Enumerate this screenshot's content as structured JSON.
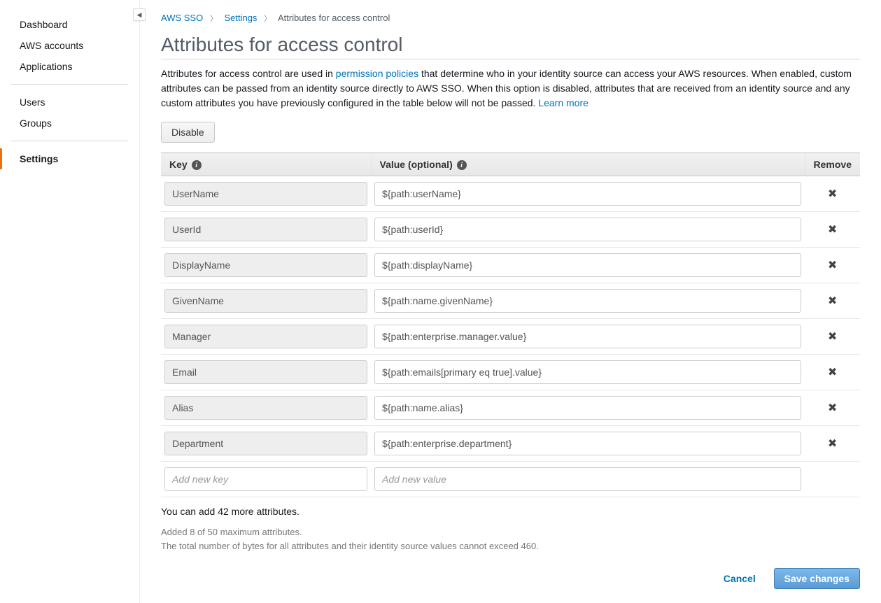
{
  "sidebar": {
    "group1": [
      {
        "label": "Dashboard"
      },
      {
        "label": "AWS accounts"
      },
      {
        "label": "Applications"
      }
    ],
    "group2": [
      {
        "label": "Users"
      },
      {
        "label": "Groups"
      }
    ],
    "group3": [
      {
        "label": "Settings",
        "active": true
      }
    ]
  },
  "breadcrumb": {
    "root": "AWS SSO",
    "mid": "Settings",
    "current": "Attributes for access control"
  },
  "title": "Attributes for access control",
  "description": {
    "part1": "Attributes for access control are used in ",
    "link1": "permission policies",
    "part2": " that determine who in your identity source can access your AWS resources. When enabled, custom attributes can be passed from an identity source directly to AWS SSO. When this option is disabled, attributes that are received from an identity source and any custom attributes you have previously configured in the table below will not be passed. ",
    "link2": "Learn more"
  },
  "buttons": {
    "disable": "Disable",
    "cancel": "Cancel",
    "save": "Save changes"
  },
  "table": {
    "headers": {
      "key": "Key",
      "value": "Value (optional)",
      "remove": "Remove"
    },
    "rows": [
      {
        "key": "UserName",
        "value": "${path:userName}"
      },
      {
        "key": "UserId",
        "value": "${path:userId}"
      },
      {
        "key": "DisplayName",
        "value": "${path:displayName}"
      },
      {
        "key": "GivenName",
        "value": "${path:name.givenName}"
      },
      {
        "key": "Manager",
        "value": "${path:enterprise.manager.value}"
      },
      {
        "key": "Email",
        "value": "${path:emails[primary eq true].value}"
      },
      {
        "key": "Alias",
        "value": "${path:name.alias}"
      },
      {
        "key": "Department",
        "value": "${path:enterprise.department}"
      }
    ],
    "placeholders": {
      "key": "Add new key",
      "value": "Add new value"
    }
  },
  "hints": {
    "remaining": "You can add 42 more attributes.",
    "added": "Added 8 of 50 maximum attributes.",
    "bytes": "The total number of bytes for all attributes and their identity source values cannot exceed 460."
  }
}
